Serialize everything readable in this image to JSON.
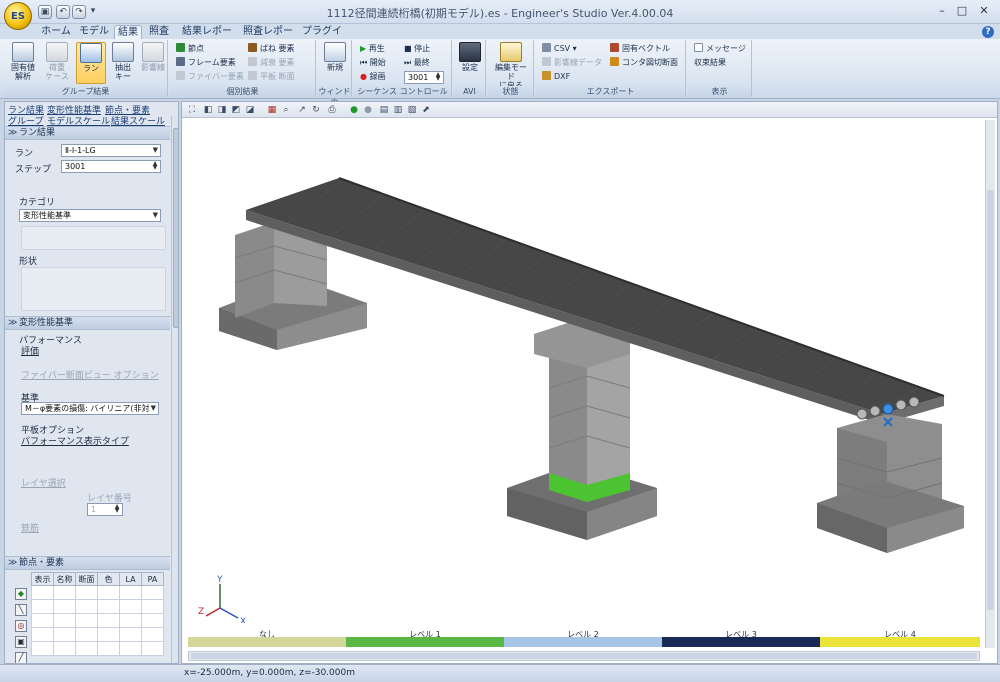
{
  "window": {
    "title": "1112径間連続桁橋(初期モデル).es - Engineer's Studio Ver.4.00.04",
    "logo_text": "ES",
    "controls": [
      "–",
      "□",
      "✕"
    ]
  },
  "ribbon_tabs": [
    "ホーム",
    "モデル",
    "結果",
    "照査",
    "結果レポート",
    "照査レポート",
    "プラグイン"
  ],
  "active_tab": "結果",
  "help_label": "?",
  "ribbon": {
    "group_result": {
      "label": "グループ結果",
      "buttons": [
        "固有値\n解析",
        "荷重\nケース",
        "ラン",
        "抽出\nキー",
        "影響線"
      ]
    },
    "group_individual": {
      "label": "個別結果",
      "items": [
        "節点",
        "フレーム要素",
        "ファイバー要素",
        "ばね 要素",
        "減衰 要素",
        "平板 断面"
      ]
    },
    "group_window": {
      "label": "ウィンドウ",
      "button": "新規"
    },
    "group_sequence": {
      "label": "シーケンス コントロール",
      "items": [
        "再生",
        "停止",
        "開始",
        "最終",
        "録画"
      ],
      "step_value": "3001"
    },
    "group_avi": {
      "label": "AVI",
      "button": "設定"
    },
    "group_state": {
      "label": "状態",
      "button": "編集モード\nに戻る"
    },
    "group_export": {
      "label": "エクスポート",
      "items": [
        "CSV",
        "固有ベクトル",
        "影響線データ",
        "コンタ図切断面",
        "DXF"
      ]
    },
    "group_display": {
      "label": "表示",
      "items": [
        "メッセージ",
        "収束結果"
      ]
    }
  },
  "left_panel": {
    "links": [
      "ラン結果",
      "変形性能基準",
      "節点・要素",
      "グループ",
      "モデルスケール",
      "結果スケール"
    ],
    "run_section": {
      "header": "ラン結果",
      "run_label": "ラン",
      "run_value": "Ⅱ-Ⅰ-1-LG",
      "step_label": "ステップ",
      "step_value": "3001",
      "category_label": "カテゴリ",
      "category_value": "変形性能基準",
      "shape_label": "形状"
    },
    "perf_section": {
      "header": "変形性能基準",
      "performance_label": "パフォーマンス",
      "evaluation_label": "評価",
      "fiber_option_label": "ファイバー断面ビュー オプション",
      "criterion_label": "基準",
      "criterion_value": "M－φ要素の損傷: バイリニア(非対",
      "plate_option_label": "平板オプション",
      "perf_display_type_label": "パフォーマンス表示タイプ",
      "layer_select_label": "レイヤ選択",
      "layer_number_label": "レイヤ番号",
      "layer_number_value": "1",
      "rebar_label": "鉄筋"
    },
    "node_section": {
      "header": "節点・要素",
      "columns": [
        "表示",
        "名称",
        "断面",
        "色",
        "LA",
        "PA"
      ]
    }
  },
  "viewport": {
    "axes": {
      "x": "X",
      "y": "Y",
      "z": "Z"
    },
    "legend": [
      {
        "label": "なし",
        "color": "#d3d79a"
      },
      {
        "label": "レベル 1",
        "color": "#5cb845"
      },
      {
        "label": "レベル 2",
        "color": "#a6c4e4"
      },
      {
        "label": "レベル 3",
        "color": "#1a2a56"
      },
      {
        "label": "レベル 4",
        "color": "#ece33a"
      }
    ]
  },
  "status": {
    "coords": "x=-25.000m, y=0.000m, z=-30.000m"
  },
  "colors": {
    "accent": "#ffcf60",
    "ribbon_bg": "#dbe5f1",
    "deck_top": "#4a4a4a",
    "pier": "#8e8e8e",
    "damage_green": "#4cc431"
  }
}
